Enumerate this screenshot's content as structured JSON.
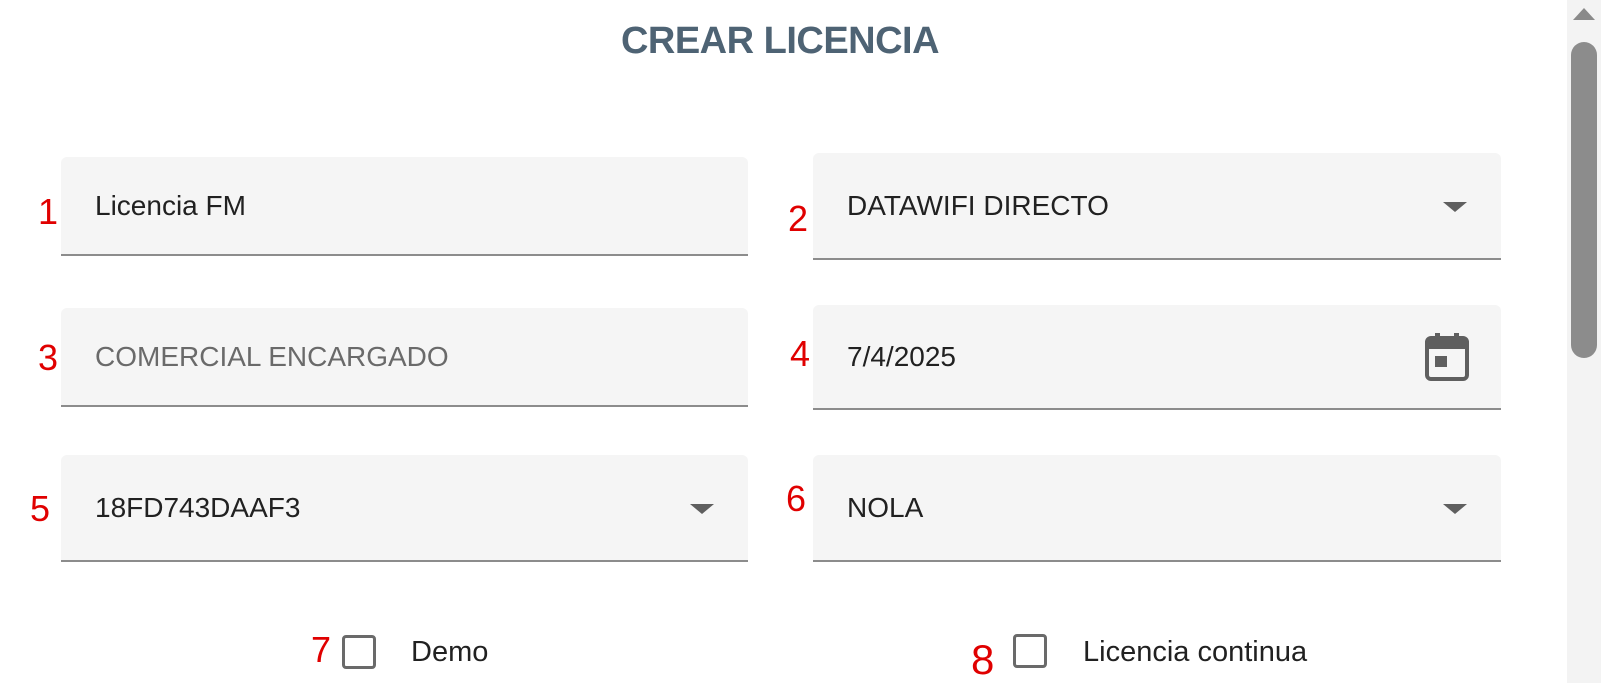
{
  "form": {
    "title": "CREAR LICENCIA",
    "fields": [
      {
        "value": "Licencia FM",
        "type": "text"
      },
      {
        "value": "DATAWIFI DIRECTO",
        "type": "select"
      },
      {
        "placeholder": "COMERCIAL ENCARGADO",
        "type": "text"
      },
      {
        "value": "7/4/2025",
        "type": "date"
      },
      {
        "value": "18FD743DAAF3",
        "type": "select"
      },
      {
        "value": "NOLA",
        "type": "select"
      }
    ],
    "checkboxes": [
      {
        "label": "Demo",
        "checked": false
      },
      {
        "label": "Licencia continua",
        "checked": false
      }
    ]
  },
  "annotations": [
    "1",
    "2",
    "3",
    "4",
    "5",
    "6",
    "7",
    "8"
  ],
  "icons": {
    "dropdown": "chevron-down-icon",
    "date": "calendar-icon"
  },
  "colors": {
    "title": "#4e6374",
    "annotation": "#e00000",
    "field_bg": "#f5f5f5"
  }
}
